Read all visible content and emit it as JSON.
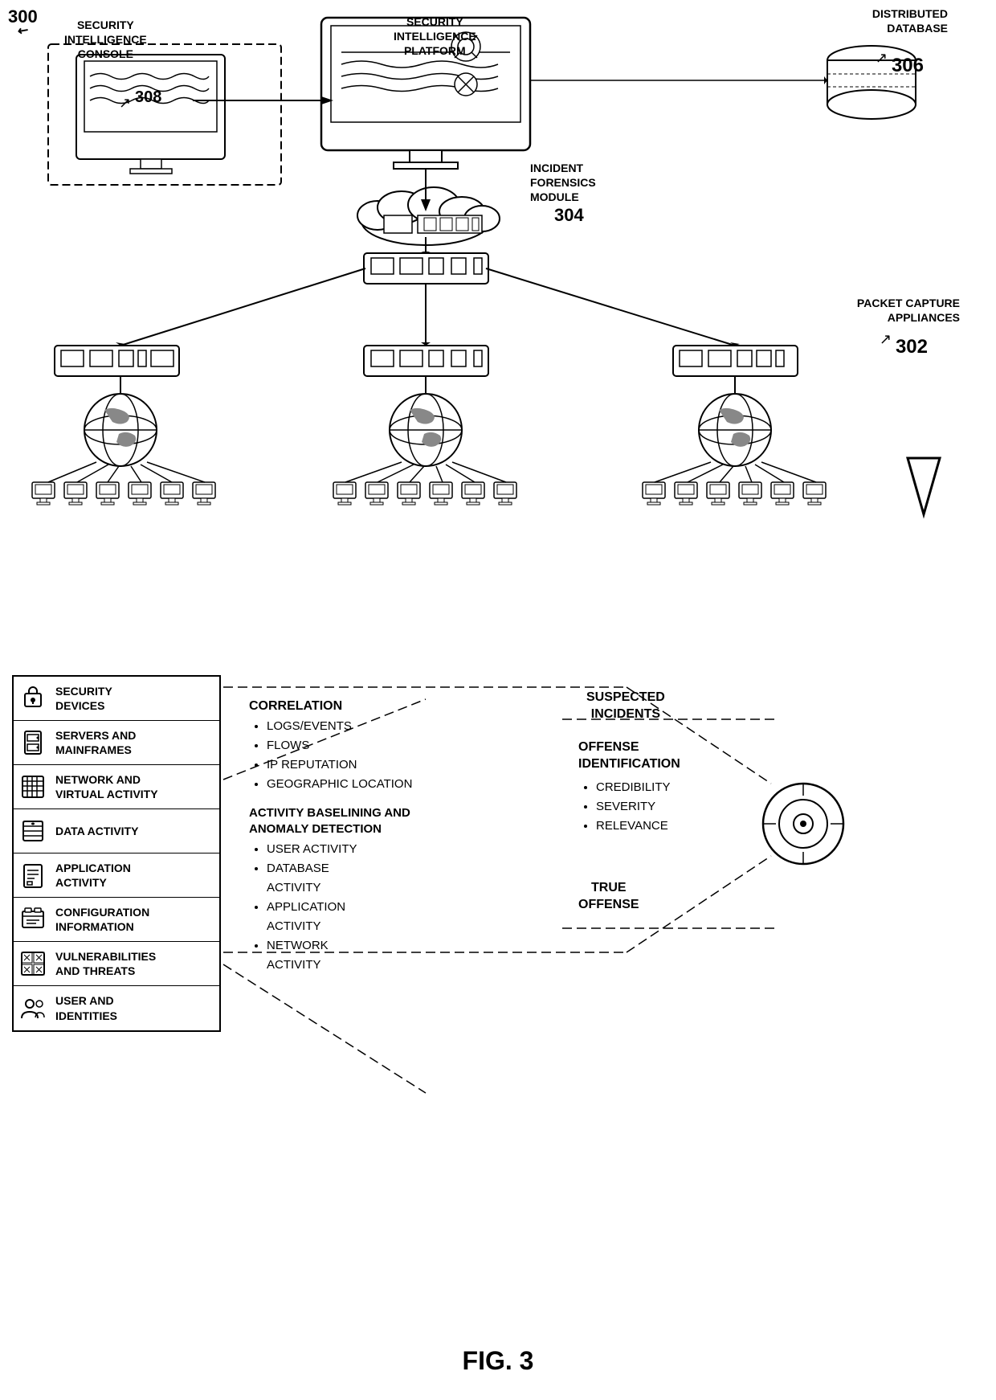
{
  "diagram": {
    "figure_number": "FIG. 3",
    "main_label": "300",
    "nodes": {
      "security_intelligence_platform": "SECURITY\nINTELLIGENCE\nPLATFORM",
      "security_intelligence_console": "SECURITY\nINTELLIGENCE\nCONSOLE",
      "console_number": "308",
      "distributed_database": "DISTRIBUTED\nDATABASE",
      "db_number": "306",
      "incident_forensics_module": "INCIDENT\nFORENSICS\nMODULE",
      "ifm_number": "304",
      "packet_capture_appliances": "PACKET CAPTURE\nAPPLIANCES",
      "pca_number": "302"
    },
    "legend": {
      "items": [
        {
          "id": "security-devices",
          "icon": "🔒",
          "text": "SECURITY\nDEVICES"
        },
        {
          "id": "servers-mainframes",
          "icon": "🗑",
          "text": "SERVERS AND\nMAINFRAMES"
        },
        {
          "id": "network-virtual",
          "icon": "📋",
          "text": "NETWORK AND\nVIRTUAL ACTIVITY"
        },
        {
          "id": "data-activity",
          "icon": "📂",
          "text": "DATA ACTIVITY"
        },
        {
          "id": "application-activity",
          "icon": "📄",
          "text": "APPLICATION\nACTIVITY"
        },
        {
          "id": "configuration-info",
          "icon": "🖨",
          "text": "CONFIGURATION\nINFORMATION"
        },
        {
          "id": "vulnerabilities-threats",
          "icon": "▦",
          "text": "VULNERABILITIES\nAND THREATS"
        },
        {
          "id": "user-identities",
          "icon": "👥",
          "text": "USER AND\nIDENTITIES"
        }
      ]
    },
    "correlation": {
      "title": "CORRELATION",
      "items": [
        "LOGS/EVENTS",
        "FLOWS",
        "IP REPUTATION",
        "GEOGRAPHIC LOCATION"
      ],
      "baselining_title": "ACTIVITY BASELINING AND\nANOMALY DETECTION",
      "baselining_items": [
        "USER ACTIVITY",
        "DATABASE\nACTIVITY",
        "APPLICATION\nACTIVITY",
        "NETWORK\nACTIVITY"
      ]
    },
    "offense_identification": {
      "title": "OFFENSE\nIDENTIFICATION",
      "items": [
        "CREDIBILITY",
        "SEVERITY",
        "RELEVANCE"
      ]
    },
    "suspected_incidents": "SUSPECTED\nINCIDENTS",
    "true_offense": "TRUE\nOFFENSE"
  }
}
